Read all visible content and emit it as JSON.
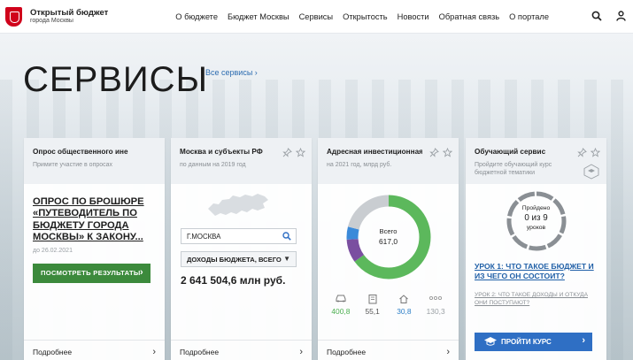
{
  "header": {
    "logo_title": "Открытый бюджет",
    "logo_subtitle": "города Москвы",
    "nav": [
      "О бюджете",
      "Бюджет Москвы",
      "Сервисы",
      "Открытость",
      "Новости",
      "Обратная связь",
      "О портале"
    ],
    "icons": [
      "search-icon",
      "user-icon"
    ]
  },
  "page": {
    "title": "СЕРВИСЫ",
    "all_services": "Все сервисы ›"
  },
  "cards": [
    {
      "title": "Опрос общественного инения",
      "subtitle": "Примите участие в опросах",
      "link": "ОПРОС ПО БРОШЮРЕ «ПУТЕВОДИТЕЛЬ ПО БЮДЖЕТУ ГОРОДА МОСКВЫ» К ЗАКОНУ...",
      "date": "до 26.02.2021",
      "button": "ПОСМОТРЕТЬ РЕЗУЛЬТАТЫ",
      "more": "Подробнее"
    },
    {
      "title": "Москва и субъекты РФ",
      "subtitle": "по данным на 2019 год",
      "input_value": "Г.МОСКВА",
      "select_value": "ДОХОДЫ БЮДЖЕТА, ВСЕГО",
      "value": "2 641 504,6 млн руб.",
      "more": "Подробнее"
    },
    {
      "title": "Адресная инвестиционная пр...",
      "subtitle": "на 2021 год, млрд руб.",
      "total_label": "Всего",
      "total_value": "617,0",
      "stats": [
        {
          "icon": "car-icon",
          "value": "400,8",
          "color": "#4caf50"
        },
        {
          "icon": "building-icon",
          "value": "55,1",
          "color": "#555555"
        },
        {
          "icon": "house-icon",
          "value": "30,8",
          "color": "#2f80c8"
        },
        {
          "icon": "dots-icon",
          "value": "130,3",
          "color": "#9aa0a5"
        }
      ],
      "segments": [
        {
          "value": 400.8,
          "color": "#5cb85c"
        },
        {
          "value": 55.1,
          "color": "#7a4fa0"
        },
        {
          "value": 30.8,
          "color": "#3b8ad9"
        },
        {
          "value": 130.3,
          "color": "#c9cdd1"
        }
      ],
      "more": "Подробнее"
    },
    {
      "title": "Обучающий сервис",
      "subtitle": "Пройдите обучающий курс бюджетной тематики",
      "progress_label_top": "Пройдено",
      "progress_label_mid": "0 из 9",
      "progress_label_bottom": "уроков",
      "progress_fraction": 0,
      "lesson1": "УРОК 1: ЧТО ТАКОЕ БЮДЖЕТ И ИЗ ЧЕГО ОН СОСТОИТ?",
      "lesson2": "УРОК 2: ЧТО ТАКОЕ ДОХОДЫ И ОТКУДА ОНИ ПОСТУПАЮТ?",
      "button": "ПРОЙТИ КУРС"
    }
  ]
}
